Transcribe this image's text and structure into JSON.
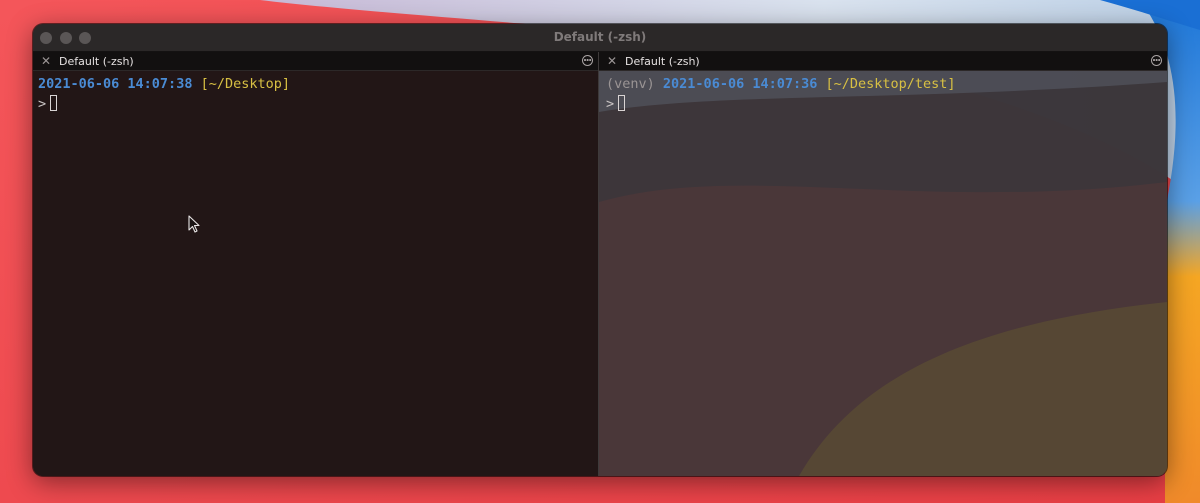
{
  "window": {
    "title": "Default (-zsh)"
  },
  "panes": [
    {
      "tab_label": "Default (-zsh)",
      "prompt_line": {
        "venv": "",
        "date": "2021-06-06",
        "time": "14:07:38",
        "path": "[~/Desktop]"
      },
      "prompt_symbol": ">"
    },
    {
      "tab_label": "Default (-zsh)",
      "prompt_line": {
        "venv": "(venv)",
        "date": "2021-06-06",
        "time": "14:07:36",
        "path": "[~/Desktop/test]"
      },
      "prompt_symbol": ">"
    }
  ],
  "icons": {
    "tab_close": "close-icon",
    "tab_menu": "more-options-icon",
    "pointer": "mouse-pointer-icon"
  },
  "colors": {
    "date_time": "#4a8bd4",
    "path": "#d8c043",
    "venv": "#9a9494",
    "wallpaper_red": "#f0484a",
    "wallpaper_blue": "#2f7fe0",
    "wallpaper_orange": "#f5a623"
  }
}
